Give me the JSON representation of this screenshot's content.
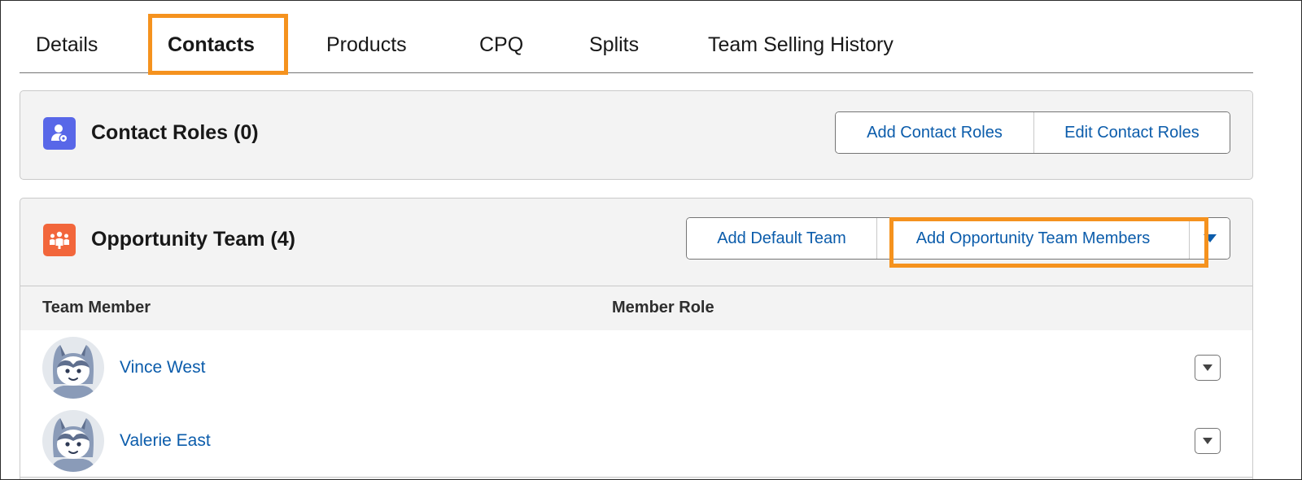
{
  "tabs": [
    {
      "label": "Details"
    },
    {
      "label": "Contacts"
    },
    {
      "label": "Products"
    },
    {
      "label": "CPQ"
    },
    {
      "label": "Splits"
    },
    {
      "label": "Team Selling History"
    }
  ],
  "active_tab": "Contacts",
  "contact_roles": {
    "icon": "contact-roles-icon",
    "title": "Contact Roles (0)",
    "add_button": "Add Contact Roles",
    "edit_button": "Edit Contact Roles",
    "icon_color": "#5867e8"
  },
  "opportunity_team": {
    "icon": "team-icon",
    "title": "Opportunity Team (4)",
    "add_default_button": "Add Default Team",
    "add_members_button": "Add Opportunity Team Members",
    "more_icon": "chevron-down-icon",
    "icon_color": "#f2663b",
    "columns": [
      "Team Member",
      "Member Role"
    ],
    "rows": [
      {
        "name": "Vince West",
        "role": ""
      },
      {
        "name": "Valerie East",
        "role": ""
      }
    ]
  },
  "colors": {
    "highlight": "#f5921e",
    "link": "#0b5cab",
    "card_bg": "#f3f3f3"
  }
}
